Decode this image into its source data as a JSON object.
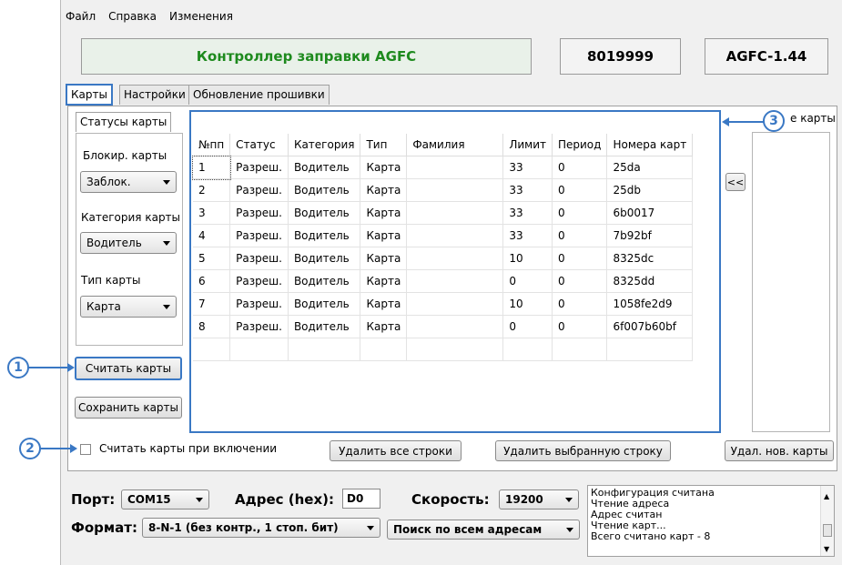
{
  "menu": [
    "Файл",
    "Справка",
    "Изменения"
  ],
  "header": {
    "title": "Контроллер заправки AGFC",
    "serial": "8019999",
    "version": "AGFC-1.44"
  },
  "tabs": [
    "Карты",
    "Настройки",
    "Обновление прошивки"
  ],
  "left_panel": {
    "group_title": "Статусы карты",
    "block_label": "Блокир. карты",
    "block_value": "Заблок.",
    "category_label": "Категория карты",
    "category_value": "Водитель",
    "type_label": "Тип карты",
    "type_value": "Карта",
    "read_button": "Считать карты",
    "save_button": "Сохранить карты"
  },
  "table": {
    "headers": [
      "№пп",
      "Статус",
      "Категория",
      "Тип",
      "Фамилия",
      "Лимит",
      "Период",
      "Номера карт"
    ],
    "rows": [
      [
        "1",
        "Разреш.",
        "Водитель",
        "Карта",
        "",
        "33",
        "0",
        "25da"
      ],
      [
        "2",
        "Разреш.",
        "Водитель",
        "Карта",
        "",
        "33",
        "0",
        "25db"
      ],
      [
        "3",
        "Разреш.",
        "Водитель",
        "Карта",
        "",
        "33",
        "0",
        "6b0017"
      ],
      [
        "4",
        "Разреш.",
        "Водитель",
        "Карта",
        "",
        "33",
        "0",
        "7b92bf"
      ],
      [
        "5",
        "Разреш.",
        "Водитель",
        "Карта",
        "",
        "10",
        "0",
        "8325dc"
      ],
      [
        "6",
        "Разреш.",
        "Водитель",
        "Карта",
        "",
        "0",
        "0",
        "8325dd"
      ],
      [
        "7",
        "Разреш.",
        "Водитель",
        "Карта",
        "",
        "10",
        "0",
        "1058fe2d9"
      ],
      [
        "8",
        "Разреш.",
        "Водитель",
        "Карта",
        "",
        "0",
        "0",
        "6f007b60bf"
      ]
    ]
  },
  "right_panel": {
    "title": "е карты",
    "move_button": "<<"
  },
  "bottom_actions": {
    "checkbox_label": "Считать карты при включении",
    "delete_all": "Удалить все строки",
    "delete_selected": "Удалить выбранную строку",
    "delete_new": "Удал. нов. карты"
  },
  "port": {
    "label": "Порт:",
    "value": "COM15"
  },
  "address": {
    "label": "Адрес (hex):",
    "value": "D0"
  },
  "speed": {
    "label": "Скорость:",
    "value": "19200"
  },
  "format": {
    "label": "Формат:",
    "value": "8-N-1 (без контр., 1 стоп. бит)"
  },
  "search_mode": "Поиск по всем адресам",
  "log_lines": [
    "Конфигурация считана",
    "Чтение адреса",
    "Адрес считан",
    "Чтение карт...",
    "Всего считано карт - 8"
  ],
  "callouts": [
    "1",
    "2",
    "3"
  ],
  "colors": {
    "accent": "#3a78c4",
    "title_green": "#1e8a1e"
  }
}
